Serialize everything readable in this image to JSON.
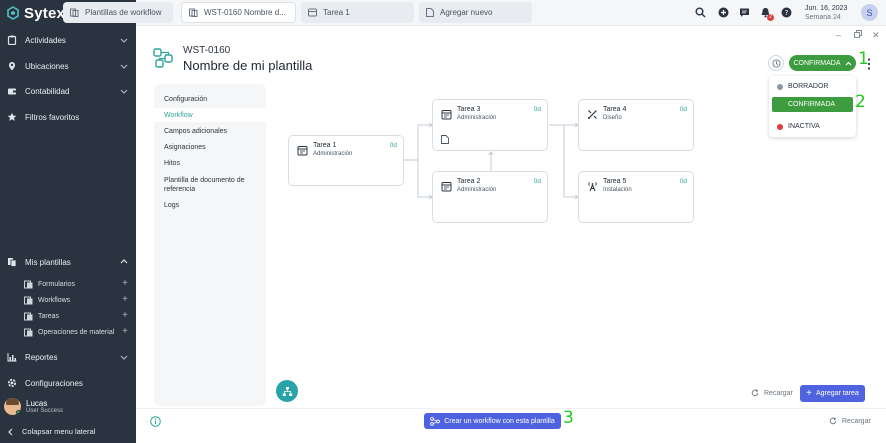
{
  "brand": {
    "name": "Sytex"
  },
  "tabs": [
    {
      "label": "Plantillas de workflow"
    },
    {
      "label": "WST-0160 Nombre d..."
    },
    {
      "label": "Tarea 1"
    },
    {
      "label": "Agregar nuevo"
    }
  ],
  "topbar": {
    "notifications_count": "2",
    "date": "Jun. 16, 2023",
    "week": "Semana 24",
    "user_initial": "S"
  },
  "sidebar": {
    "items": [
      {
        "label": "Actividades"
      },
      {
        "label": "Ubicaciones"
      },
      {
        "label": "Contabilidad"
      },
      {
        "label": "Filtros favoritos"
      }
    ],
    "templates": {
      "label": "Mis plantillas",
      "children": [
        {
          "label": "Formularios"
        },
        {
          "label": "Workflows"
        },
        {
          "label": "Tareas"
        },
        {
          "label": "Operaciones de material"
        }
      ]
    },
    "bottom_items": [
      {
        "label": "Reportes"
      },
      {
        "label": "Configuraciones"
      }
    ],
    "user": {
      "name": "Lucas",
      "status": "User Success"
    },
    "collapse_label": "Colapsar menu lateral"
  },
  "header": {
    "code": "WST-0160",
    "title": "Nombre de mi plantilla"
  },
  "status": {
    "current": "CONFIRMADA",
    "options": [
      {
        "label": "BORRADOR",
        "color": "#8a96a3"
      },
      {
        "label": "CONFIRMADA",
        "color": "#3d9c3f"
      },
      {
        "label": "INACTIVA",
        "color": "#e03b3b"
      }
    ]
  },
  "annotations": {
    "one": "1",
    "two": "2",
    "three": "3"
  },
  "menu": {
    "items": [
      {
        "label": "Configuración"
      },
      {
        "label": "Workflow"
      },
      {
        "label": "Campos adicionales"
      },
      {
        "label": "Asignaciones"
      },
      {
        "label": "Hitos"
      },
      {
        "label": "Plantilla de documento de referencia"
      },
      {
        "label": "Logs"
      }
    ],
    "active": "Workflow"
  },
  "tasks": [
    {
      "title": "Tarea 1",
      "role": "Administración",
      "days": "0d",
      "icon": "calendar-icon"
    },
    {
      "title": "Tarea 3",
      "role": "Administración",
      "days": "0d",
      "icon": "calendar-icon"
    },
    {
      "title": "Tarea 2",
      "role": "Administración",
      "days": "0d",
      "icon": "calendar-icon"
    },
    {
      "title": "Tarea 4",
      "role": "Diseño",
      "days": "0d",
      "icon": "design-tools-icon"
    },
    {
      "title": "Tarea 5",
      "role": "Instalación",
      "days": "0d",
      "icon": "antenna-icon"
    }
  ],
  "actions": {
    "reload": "Recargar",
    "add_task": "Agregar tarea",
    "create_workflow": "Crear un workflow con esta plantilla"
  },
  "colors": {
    "sidebar_bg": "#2a3440",
    "accent_teal": "#2fa59a",
    "primary_button": "#4f63e0",
    "status_green": "#3d9c3f",
    "annotation_green": "#22c922"
  }
}
